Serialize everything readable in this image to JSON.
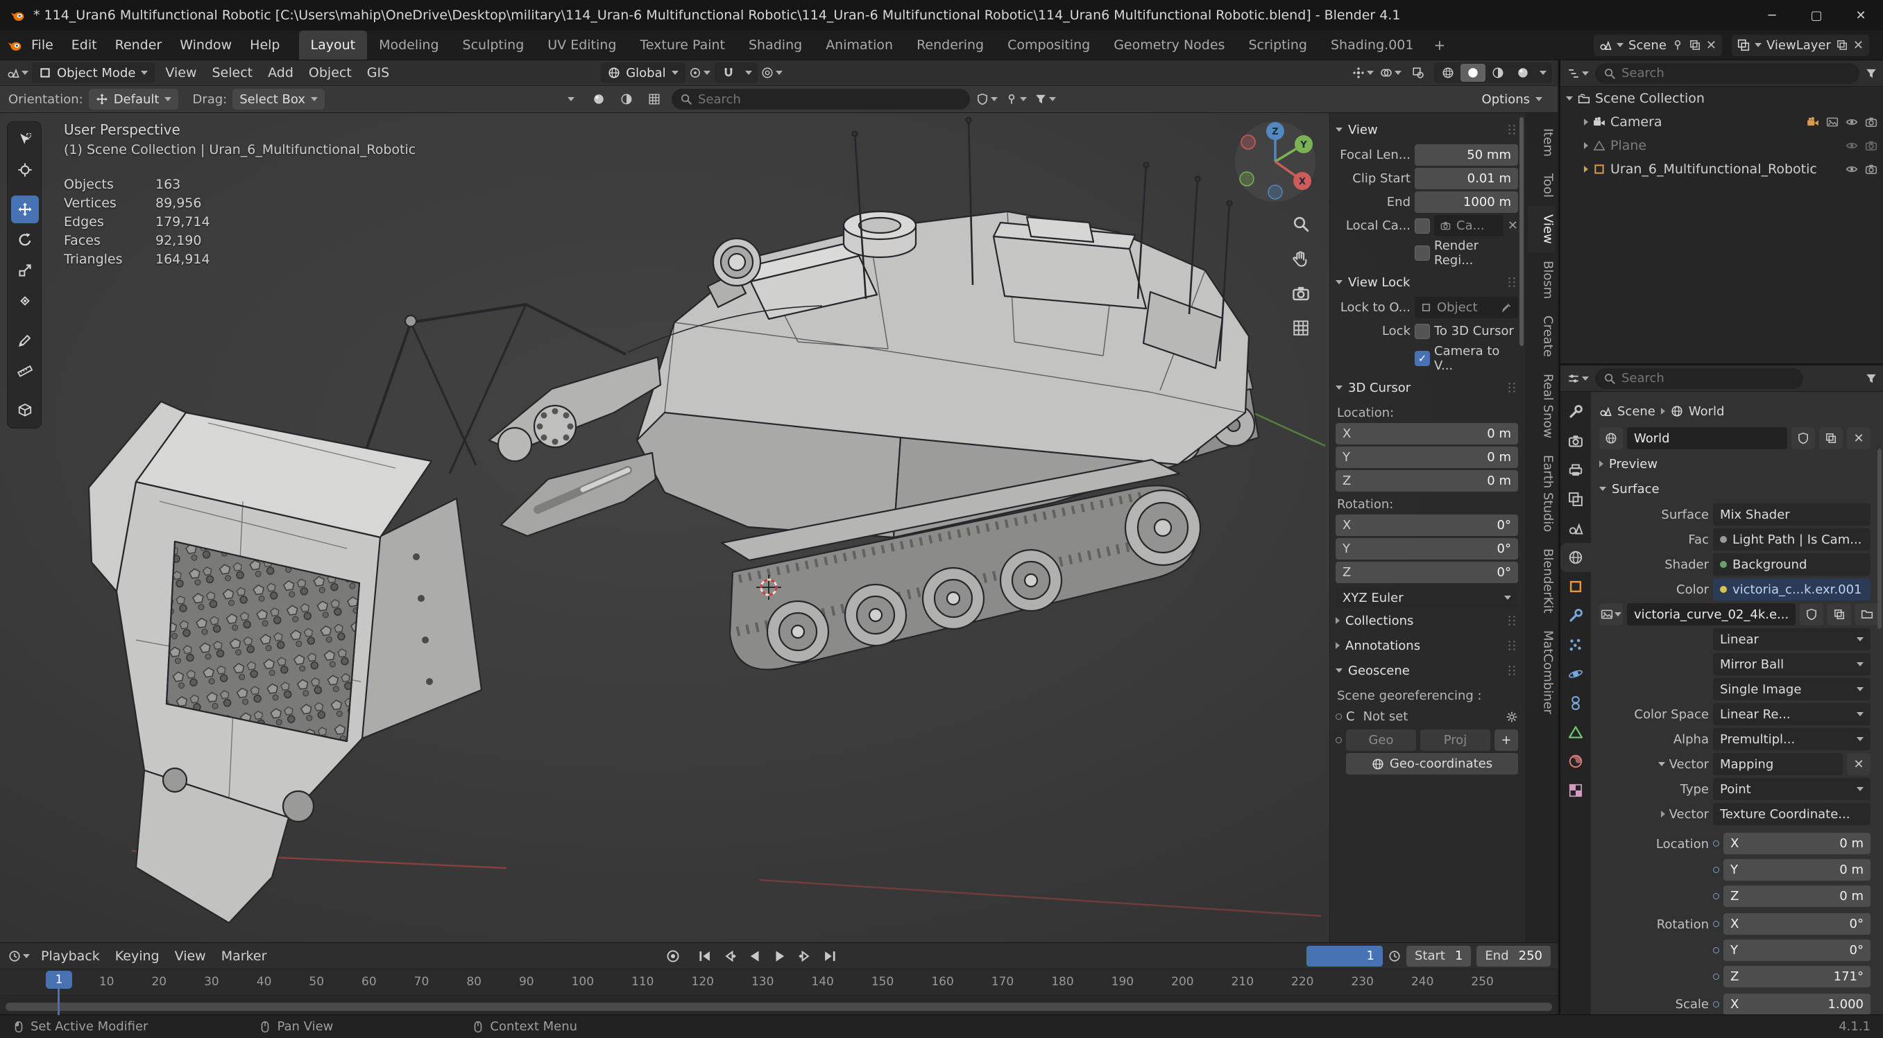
{
  "window": {
    "title": "* 114_Uran6 Multifunctional Robotic [C:\\Users\\mahip\\OneDrive\\Desktop\\military\\114_Uran-6 Multifunctional Robotic\\114_Uran-6 Multifunctional Robotic\\114_Uran6 Multifunctional Robotic.blend] - Blender 4.1"
  },
  "icons": {
    "close": "✕",
    "minimize": "─",
    "maximize": "▢",
    "check": "✓",
    "plus": "+"
  },
  "colors": {
    "accent_blue": "#4772b3",
    "object_orange": "#e8883a",
    "axis_x": "#cd5c5a",
    "axis_y": "#7bb254",
    "axis_z": "#5387c2"
  },
  "menubar": {
    "menus": [
      {
        "label": "File"
      },
      {
        "label": "Edit"
      },
      {
        "label": "Render"
      },
      {
        "label": "Window"
      },
      {
        "label": "Help"
      }
    ],
    "workspaces": [
      {
        "label": "Layout",
        "active": true
      },
      {
        "label": "Modeling"
      },
      {
        "label": "Sculpting"
      },
      {
        "label": "UV Editing"
      },
      {
        "label": "Texture Paint"
      },
      {
        "label": "Shading"
      },
      {
        "label": "Animation"
      },
      {
        "label": "Rendering"
      },
      {
        "label": "Compositing"
      },
      {
        "label": "Geometry Nodes"
      },
      {
        "label": "Scripting"
      },
      {
        "label": "Shading.001"
      }
    ],
    "add_workspace": "+",
    "scene_label": "Scene",
    "viewlayer_label": "ViewLayer"
  },
  "viewport_header": {
    "mode": "Object Mode",
    "menus": [
      {
        "label": "View"
      },
      {
        "label": "Select"
      },
      {
        "label": "Add"
      },
      {
        "label": "Object"
      },
      {
        "label": "GIS"
      }
    ],
    "orientation": "Global"
  },
  "tool_settings": {
    "orientation_label": "Orientation:",
    "orientation_value": "Default",
    "drag_label": "Drag:",
    "drag_value": "Select Box",
    "search_placeholder": "Search",
    "options_label": "Options"
  },
  "viewport": {
    "perspective_label": "User Perspective",
    "collection_label": "(1) Scene Collection | Uran_6_Multifunctional_Robotic",
    "stats": [
      {
        "label": "Objects",
        "value": "163"
      },
      {
        "label": "Vertices",
        "value": "89,956"
      },
      {
        "label": "Edges",
        "value": "179,714"
      },
      {
        "label": "Faces",
        "value": "92,190"
      },
      {
        "label": "Triangles",
        "value": "164,914"
      }
    ],
    "gizmo": {
      "x": "X",
      "y": "Y",
      "z": "Z"
    }
  },
  "npanel": {
    "tabs": [
      {
        "label": "Item"
      },
      {
        "label": "Tool"
      },
      {
        "label": "View",
        "active": true
      },
      {
        "label": "Blosm"
      },
      {
        "label": "Create"
      },
      {
        "label": "Real Snow"
      },
      {
        "label": "Earth Studio"
      },
      {
        "label": "BlenderKit"
      },
      {
        "label": "MatCombiner"
      }
    ],
    "view": {
      "title": "View",
      "focal_label": "Focal Len...",
      "focal_value": "50 mm",
      "clip_start_label": "Clip Start",
      "clip_start_value": "0.01 m",
      "clip_end_label": "End",
      "clip_end_value": "1000 m",
      "local_camera_label": "Local Ca...",
      "local_camera_value": "Ca...",
      "render_region_label": "Render Regi..."
    },
    "view_lock": {
      "title": "View Lock",
      "lock_to_object_label": "Lock to O...",
      "object_value": "Object",
      "lock_label": "Lock",
      "to_3d_cursor_label": "To 3D Cursor",
      "camera_to_view_label": "Camera to V..."
    },
    "cursor3d": {
      "title": "3D Cursor",
      "location_label": "Location:",
      "location": [
        {
          "axis": "X",
          "value": "0 m"
        },
        {
          "axis": "Y",
          "value": "0 m"
        },
        {
          "axis": "Z",
          "value": "0 m"
        }
      ],
      "rotation_label": "Rotation:",
      "rotation": [
        {
          "axis": "X",
          "value": "0°"
        },
        {
          "axis": "Y",
          "value": "0°"
        },
        {
          "axis": "Z",
          "value": "0°"
        }
      ],
      "euler_mode": "XYZ Euler"
    },
    "collections_title": "Collections",
    "annotations_title": "Annotations",
    "geoscene": {
      "title": "Geoscene",
      "georef_label": "Scene georeferencing :",
      "crs_letter": "C",
      "crs_value": "Not set",
      "geo_button": "Geo",
      "proj_button": "Proj",
      "add_button": "+",
      "geocoordinates_button": "Geo-coordinates"
    }
  },
  "outliner": {
    "search_placeholder": "Search",
    "scene_collection": "Scene Collection",
    "items": [
      {
        "name": "Camera"
      },
      {
        "name": "Plane",
        "dimmed": true
      },
      {
        "name": "Uran_6_Multifunctional_Robotic"
      }
    ]
  },
  "properties": {
    "search_placeholder": "Search",
    "breadcrumb": {
      "scene": "Scene",
      "world": "World"
    },
    "world_block": "World",
    "preview_title": "Preview",
    "surface": {
      "title": "Surface",
      "surface_label": "Surface",
      "surface_value": "Mix Shader",
      "fac_label": "Fac",
      "fac_value": "Light Path | Is Cam...",
      "shader_label": "Shader",
      "shader_value": "Background",
      "color_label": "Color",
      "color_value": "victoria_c...k.exr.001",
      "image_block": "victoria_curve_02_4k.e...",
      "interpolation": "Linear",
      "projection": "Mirror Ball",
      "image_source": "Single Image",
      "color_space_label": "Color Space",
      "color_space_value": "Linear Re...",
      "alpha_label": "Alpha",
      "alpha_value": "Premultipl...",
      "vector_label": "Vector",
      "vector_value": "Mapping",
      "type_label": "Type",
      "type_value": "Point",
      "vector2_label": "Vector",
      "vector2_value": "Texture Coordinate...",
      "location_label": "Location",
      "location": [
        {
          "axis": "X",
          "value": "0 m"
        },
        {
          "axis": "Y",
          "value": "0 m"
        },
        {
          "axis": "Z",
          "value": "0 m"
        }
      ],
      "rotation_label": "Rotation",
      "rotation": [
        {
          "axis": "X",
          "value": "0°"
        },
        {
          "axis": "Y",
          "value": "0°"
        },
        {
          "axis": "Z",
          "value": "171°"
        }
      ],
      "scale_label": "Scale",
      "scale": [
        {
          "axis": "X",
          "value": "1.000"
        }
      ]
    }
  },
  "timeline": {
    "menus": [
      {
        "label": "Playback",
        "chev": true
      },
      {
        "label": "Keying",
        "chev": true
      },
      {
        "label": "View"
      },
      {
        "label": "Marker"
      }
    ],
    "current_frame": "1",
    "start_label": "Start",
    "start_value": "1",
    "end_label": "End",
    "end_value": "250",
    "ticks": [
      "1",
      "10",
      "20",
      "30",
      "40",
      "50",
      "60",
      "70",
      "80",
      "90",
      "100",
      "110",
      "120",
      "130",
      "140",
      "150",
      "160",
      "170",
      "180",
      "190",
      "200",
      "210",
      "220",
      "230",
      "240",
      "250"
    ]
  },
  "statusbar": {
    "hint_left": "Set Active Modifier",
    "hint_middle": "Pan View",
    "hint_right": "Context Menu",
    "version": "4.1.1"
  }
}
